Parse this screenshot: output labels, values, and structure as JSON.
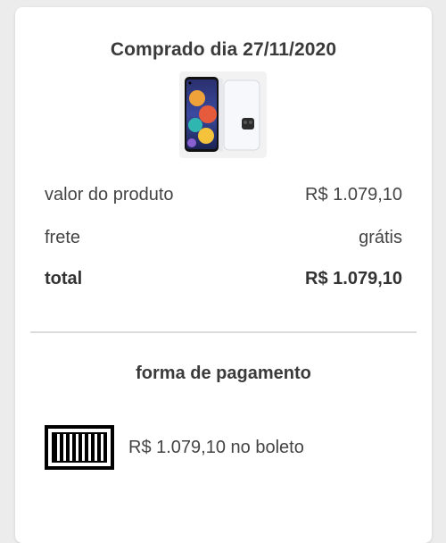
{
  "purchase": {
    "title": "Comprado dia 27/11/2020",
    "product_image_icon": "smartphone-product-image"
  },
  "summary": {
    "product_value_label": "valor do produto",
    "product_value": "R$ 1.079,10",
    "shipping_label": "frete",
    "shipping_value": "grátis",
    "total_label": "total",
    "total_value": "R$ 1.079,10"
  },
  "payment": {
    "title": "forma de pagamento",
    "method_icon": "barcode-icon",
    "method_text": "R$ 1.079,10 no boleto"
  },
  "colors": {
    "background": "#ececec",
    "card": "#ffffff",
    "text": "#444444",
    "divider": "#dcdcdc"
  }
}
